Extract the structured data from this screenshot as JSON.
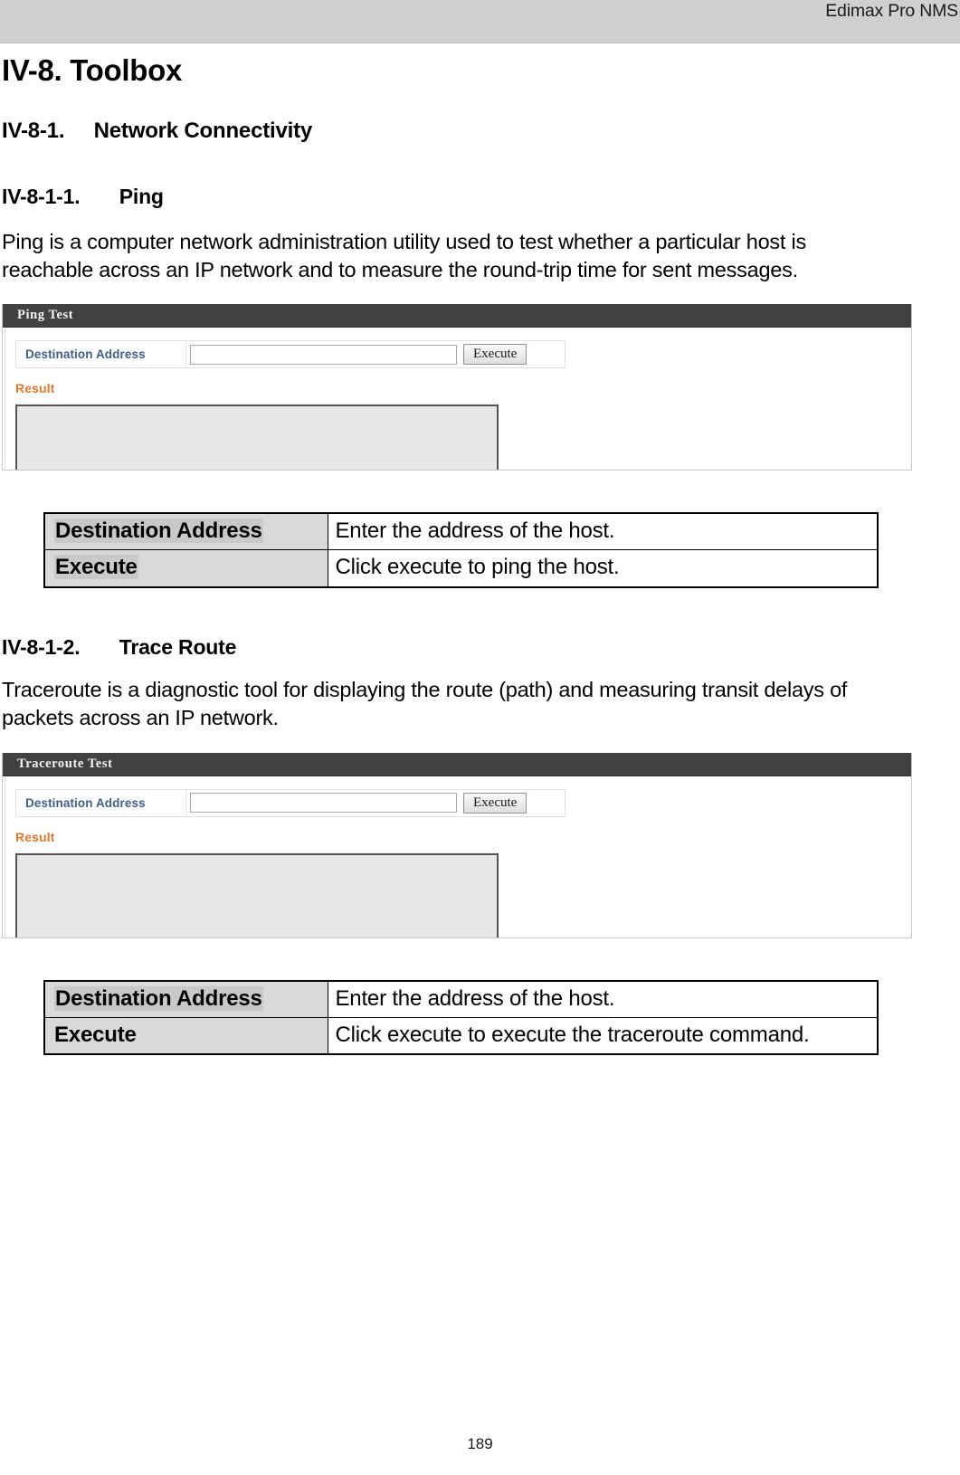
{
  "header": {
    "running_title": "Edimax Pro NMS"
  },
  "document": {
    "chapter_title": "IV-8. Toolbox",
    "section": {
      "number": "IV-8-1.",
      "title": "Network Connectivity"
    },
    "subsections": [
      {
        "number": "IV-8-1-1.",
        "title": "Ping",
        "body": "Ping is a computer network administration utility used to test whether a particular host is reachable across an IP network and to measure the round-trip time for sent messages.",
        "screenshot": {
          "panel_title": "Ping Test",
          "field_label": "Destination Address",
          "field_value": "",
          "field_placeholder": "",
          "execute_button": "Execute",
          "result_label": "Result",
          "result_value": ""
        },
        "table": {
          "rows": [
            {
              "key": "Destination Address",
              "value": "Enter the address of the host."
            },
            {
              "key": "Execute",
              "value": "Click execute to ping the host."
            }
          ]
        }
      },
      {
        "number": "IV-8-1-2.",
        "title": "Trace Route",
        "body": "Traceroute is a diagnostic tool for displaying the route (path) and measuring transit delays of packets across an IP network.",
        "screenshot": {
          "panel_title": "Traceroute Test",
          "field_label": "Destination Address",
          "field_value": "",
          "field_placeholder": "",
          "execute_button": "Execute",
          "result_label": "Result",
          "result_value": ""
        },
        "table": {
          "rows": [
            {
              "key": "Destination Address",
              "value": "Enter the address of the host."
            },
            {
              "key": "Execute",
              "value": "Click execute to execute the traceroute command."
            }
          ]
        }
      }
    ]
  },
  "footer": {
    "page_number": "189"
  },
  "colors": {
    "header_band": "#d0d0d0",
    "panel_titlebar": "#414141",
    "field_label_blue": "#3f5e8c",
    "result_label_orange": "#e0762e",
    "result_box_fill": "#e7e7e7",
    "table_key_fill": "#d9d9d9",
    "table_key_highlight": "#c9c9c9"
  }
}
